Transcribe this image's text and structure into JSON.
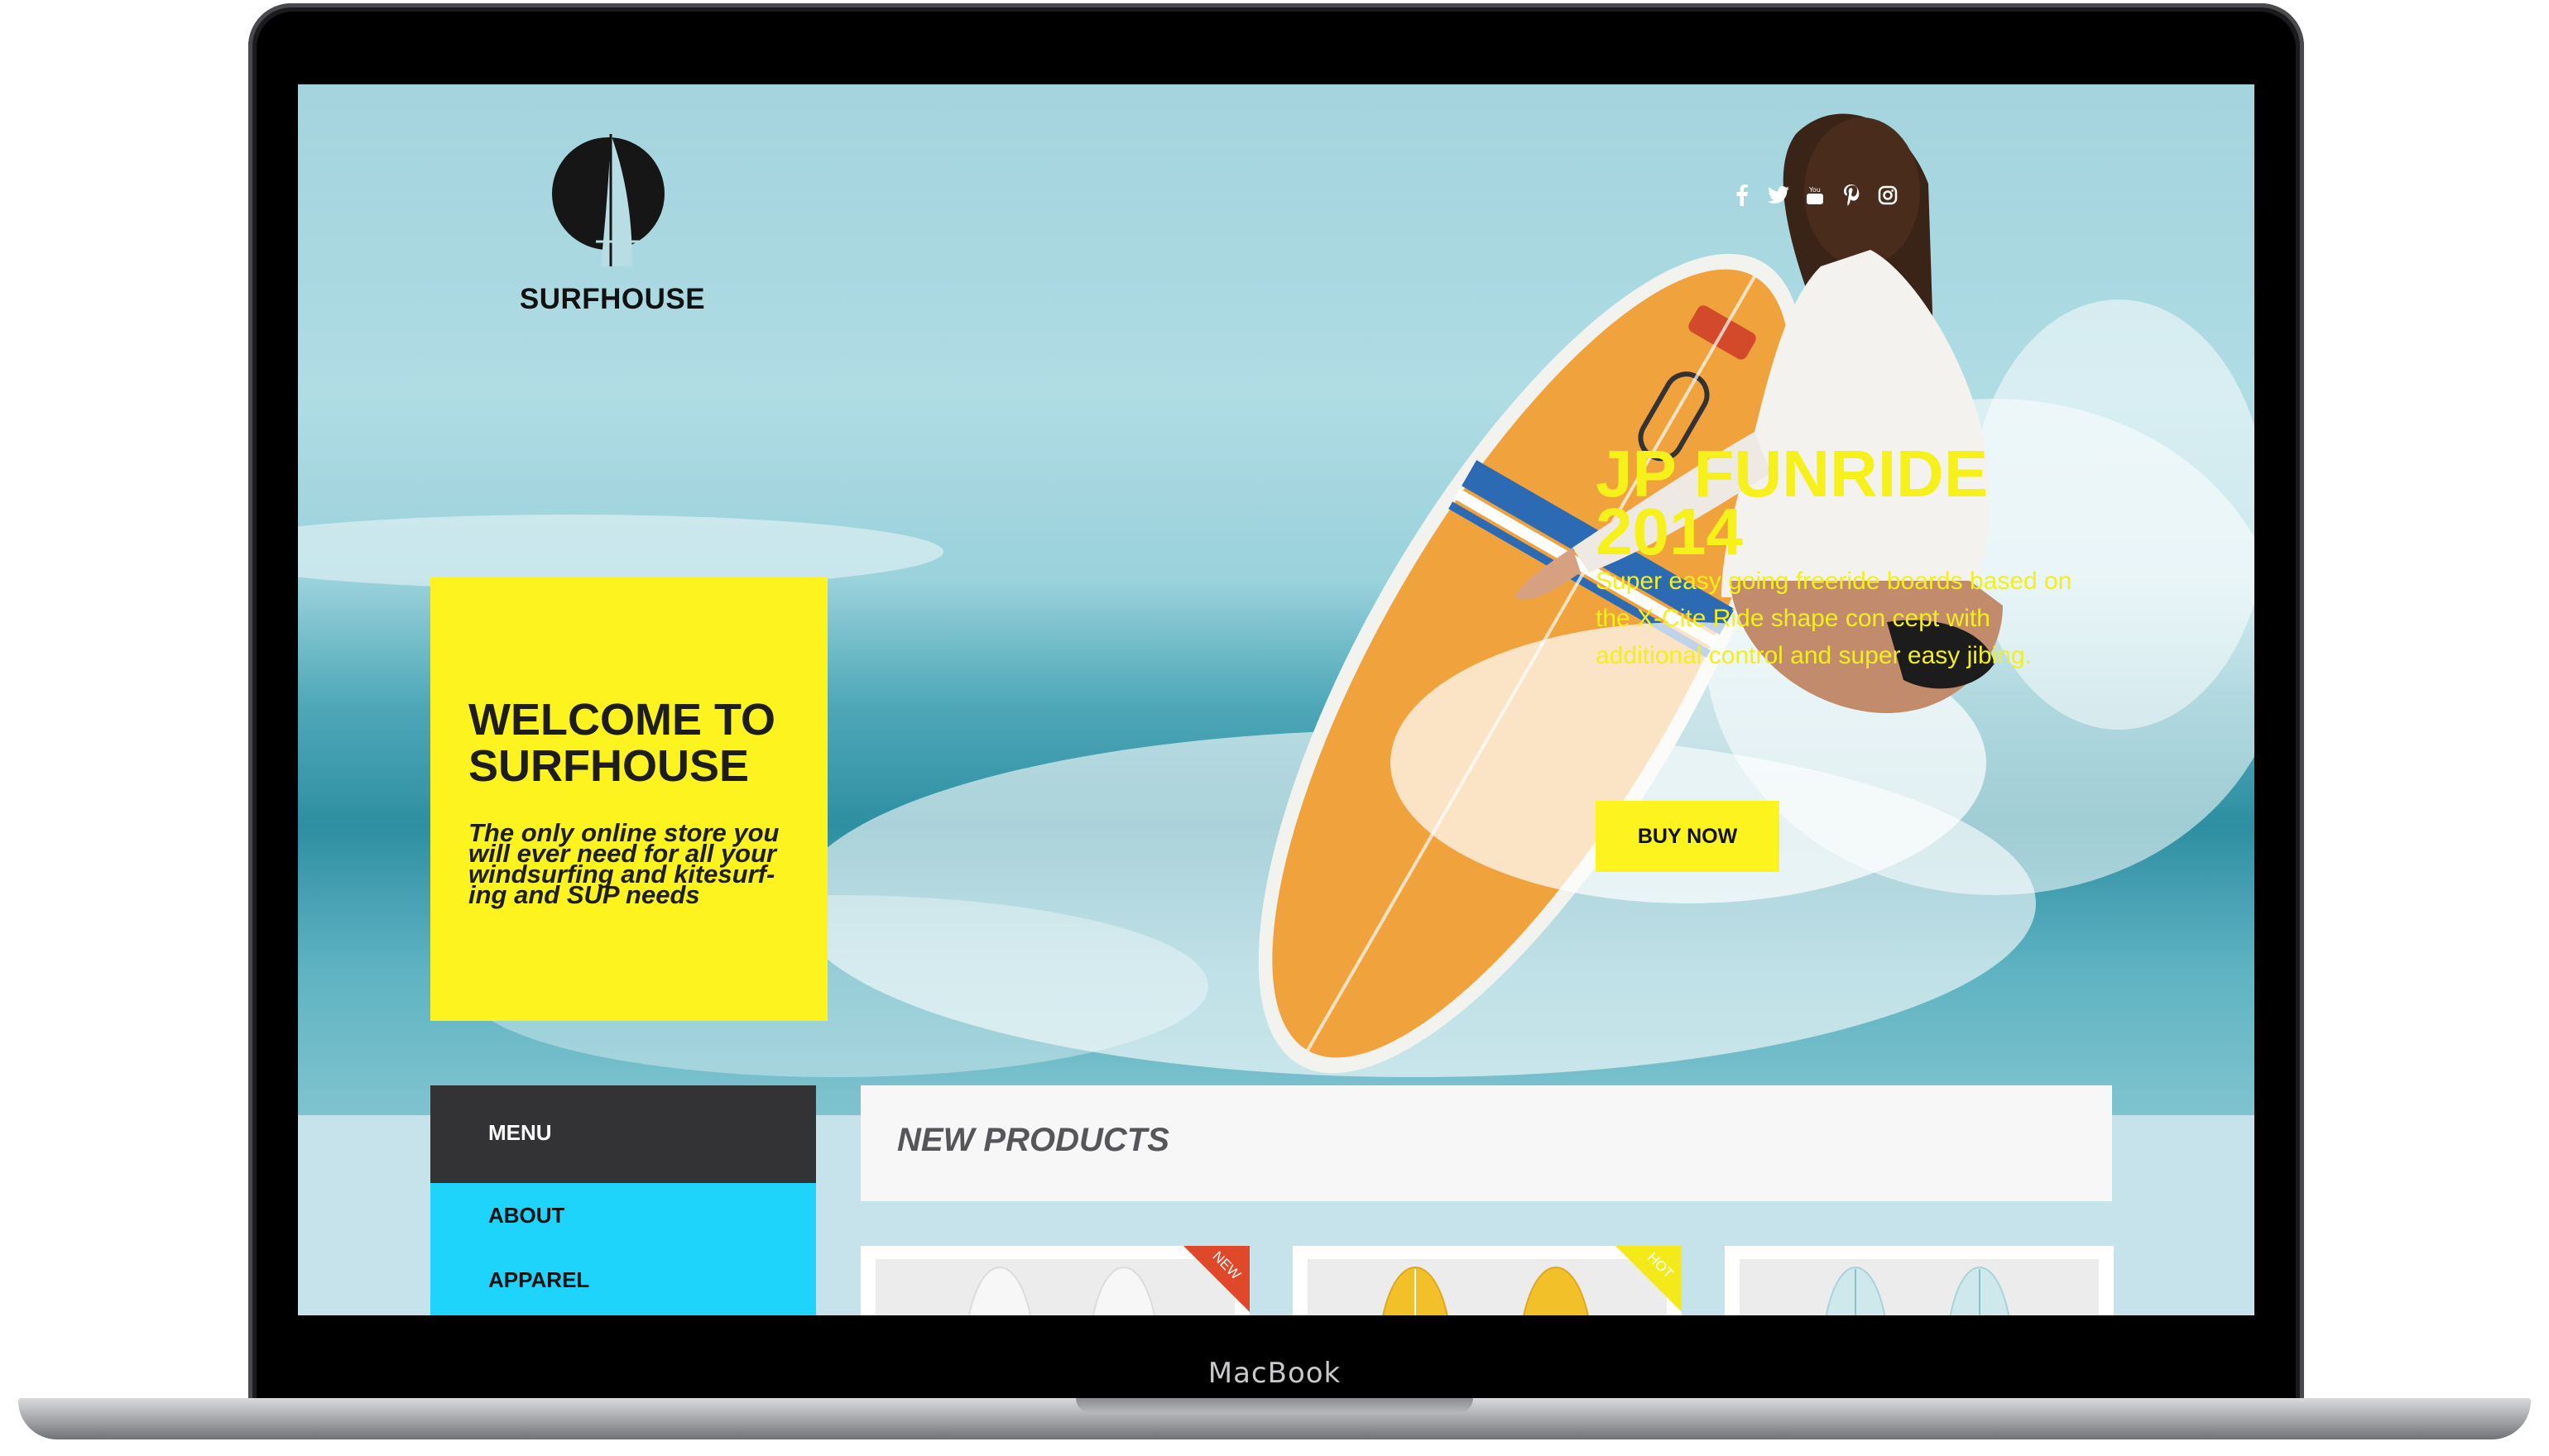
{
  "device": {
    "brand_label": "MacBook"
  },
  "site": {
    "logo_text": "SURFHOUSE",
    "social": [
      "facebook-icon",
      "twitter-icon",
      "youtube-icon",
      "pinterest-icon",
      "instagram-icon"
    ],
    "welcome": {
      "title": "WELCOME TO SURFHOUSE",
      "subtitle": "The only online store you will ever need for all your windsurfing and kitesurf-ing and SUP needs"
    },
    "promo": {
      "title": "JP FUNRIDE 2014",
      "text": "Super easy going freeride boards based on the X-Cite Ride shape con cept with additional control and super easy jibing.",
      "button": "BUY NOW"
    },
    "menu": {
      "header": "MENU",
      "items": [
        "ABOUT",
        "APPAREL"
      ]
    },
    "new_products": {
      "title": "NEW PRODUCTS",
      "cards": [
        {
          "badge": "NEW",
          "badge_color": "#e0482a",
          "board_color": "#f4f4f4"
        },
        {
          "badge": "HOT",
          "badge_color": "#f4ea1a",
          "board_color": "#f2c12a"
        },
        {
          "badge": "",
          "badge_color": "",
          "board_color": "#b8dde3"
        }
      ]
    }
  },
  "colors": {
    "accent_yellow": "#fcf31f",
    "menu_dark": "#333336",
    "menu_cyan": "#1fd4fa"
  }
}
